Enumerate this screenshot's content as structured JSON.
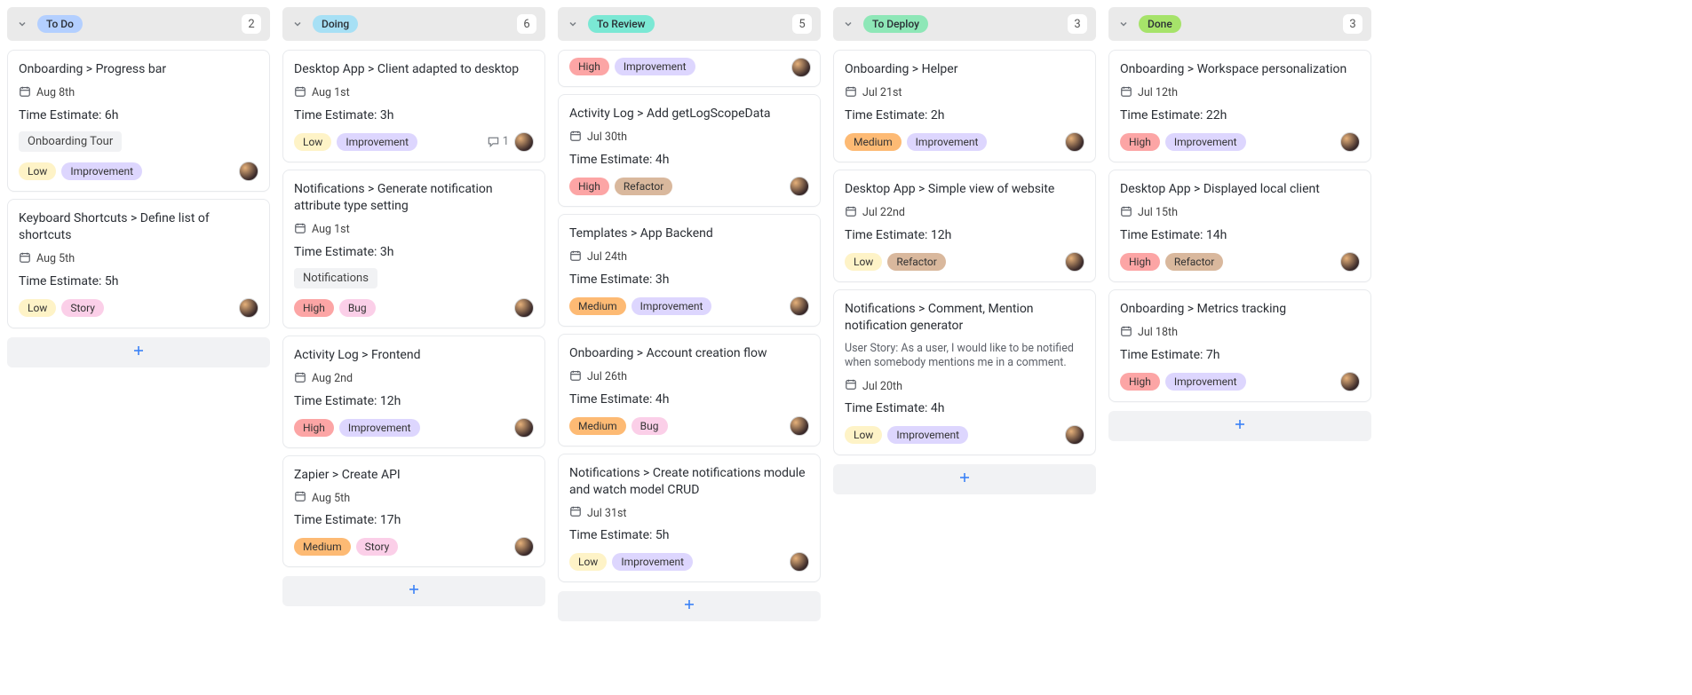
{
  "colors": {
    "status": {
      "To Do": "#b3cfff",
      "Doing": "#a7e0f5",
      "To Review": "#7be8d4",
      "To Deploy": "#8ee7b7",
      "Done": "#a6e36a"
    },
    "tags": {
      "Low": "#fef3c7",
      "Medium": "#fdba74",
      "High": "#fca5a5",
      "Improvement": "#ddd6fe",
      "Story": "#fbcfe8",
      "Bug": "#fbcfe8",
      "Refactor": "#d9b89d"
    }
  },
  "columns": [
    {
      "name": "To Do",
      "count": "2",
      "cards": [
        {
          "title": "Onboarding > Progress bar",
          "date": "Aug 8th",
          "estimate": "Time Estimate: 6h",
          "extraField": "Onboarding Tour",
          "tags": [
            "Low",
            "Improvement"
          ],
          "avatar": true
        },
        {
          "title": "Keyboard Shortcuts > Define list of shortcuts",
          "date": "Aug 5th",
          "estimate": "Time Estimate: 5h",
          "tags": [
            "Low",
            "Story"
          ],
          "avatar": true
        }
      ]
    },
    {
      "name": "Doing",
      "count": "6",
      "cards": [
        {
          "title": "Desktop App > Client adapted to desktop",
          "date": "Aug 1st",
          "estimate": "Time Estimate: 3h",
          "tags": [
            "Low",
            "Improvement"
          ],
          "comments": "1",
          "avatar": true
        },
        {
          "title": "Notifications > Generate notification attribute type setting",
          "date": "Aug 1st",
          "estimate": "Time Estimate: 3h",
          "extraField": "Notifications",
          "tags": [
            "High",
            "Bug"
          ],
          "avatar": true
        },
        {
          "title": "Activity Log > Frontend",
          "date": "Aug 2nd",
          "estimate": "Time Estimate: 12h",
          "tags": [
            "High",
            "Improvement"
          ],
          "avatar": true
        },
        {
          "title": "Zapier > Create API",
          "date": "Aug 5th",
          "estimate": "Time Estimate: 17h",
          "tags": [
            "Medium",
            "Story"
          ],
          "avatar": true
        }
      ]
    },
    {
      "name": "To Review",
      "count": "5",
      "partialTop": {
        "tags": [
          "High",
          "Improvement"
        ],
        "avatar": true
      },
      "cards": [
        {
          "title": "Activity Log > Add getLogScopeData",
          "date": "Jul 30th",
          "estimate": "Time Estimate: 4h",
          "tags": [
            "High",
            "Refactor"
          ],
          "avatar": true
        },
        {
          "title": "Templates > App Backend",
          "date": "Jul 24th",
          "estimate": "Time Estimate: 3h",
          "tags": [
            "Medium",
            "Improvement"
          ],
          "avatar": true
        },
        {
          "title": "Onboarding > Account creation flow",
          "date": "Jul 26th",
          "estimate": "Time Estimate: 4h",
          "tags": [
            "Medium",
            "Bug"
          ],
          "avatar": true
        },
        {
          "title": "Notifications > Create notifications module and watch model CRUD",
          "date": "Jul 31st",
          "estimate": "Time Estimate: 5h",
          "tags": [
            "Low",
            "Improvement"
          ],
          "avatar": true
        }
      ]
    },
    {
      "name": "To Deploy",
      "count": "3",
      "cards": [
        {
          "title": "Onboarding > Helper",
          "date": "Jul 21st",
          "estimate": "Time Estimate: 2h",
          "tags": [
            "Medium",
            "Improvement"
          ],
          "avatar": true
        },
        {
          "title": "Desktop App > Simple view of website",
          "date": "Jul 22nd",
          "estimate": "Time Estimate: 12h",
          "tags": [
            "Low",
            "Refactor"
          ],
          "avatar": true
        },
        {
          "title": "Notifications > Comment, Mention notification generator",
          "description": "User Story: As a user, I would like to be notified when somebody mentions me in a comment.",
          "date": "Jul 20th",
          "estimate": "Time Estimate: 4h",
          "tags": [
            "Low",
            "Improvement"
          ],
          "avatar": true
        }
      ]
    },
    {
      "name": "Done",
      "count": "3",
      "cards": [
        {
          "title": "Onboarding > Workspace personalization",
          "date": "Jul 12th",
          "estimate": "Time Estimate: 22h",
          "tags": [
            "High",
            "Improvement"
          ],
          "avatar": true
        },
        {
          "title": "Desktop App > Displayed local client",
          "date": "Jul 15th",
          "estimate": "Time Estimate: 14h",
          "tags": [
            "High",
            "Refactor"
          ],
          "avatar": true
        },
        {
          "title": "Onboarding > Metrics tracking",
          "date": "Jul 18th",
          "estimate": "Time Estimate: 7h",
          "tags": [
            "High",
            "Improvement"
          ],
          "avatar": true
        }
      ]
    }
  ]
}
